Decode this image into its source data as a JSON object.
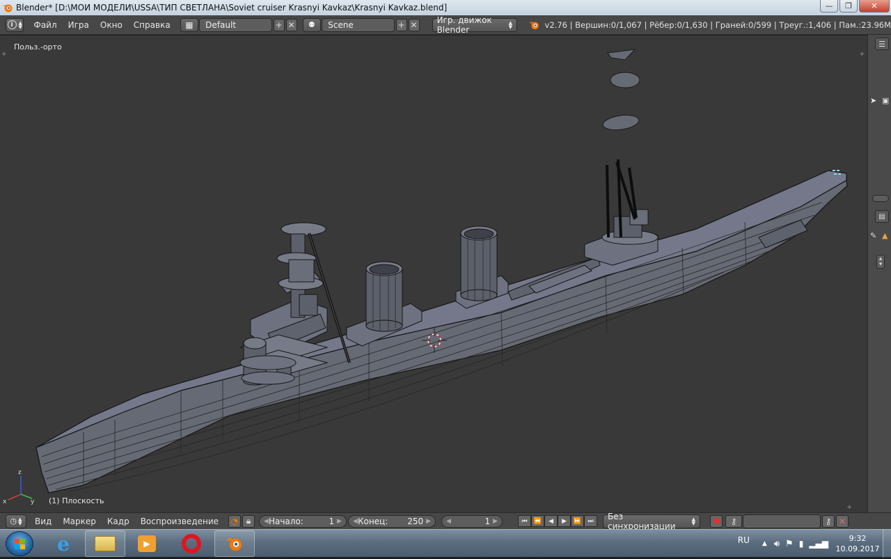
{
  "window": {
    "title": "Blender* [D:\\МОИ МОДЕЛИ\\USSA\\ТИП СВЕТЛАНА\\Soviet cruiser Krasnyi Kavkaz\\Krasnyi Kavkaz.blend]",
    "minimize": "—",
    "maximize": "❐",
    "close": "✕"
  },
  "info_header": {
    "menus": [
      "Файл",
      "Игра",
      "Окно",
      "Справка"
    ],
    "screen_layout": "Default",
    "scene": "Scene",
    "engine": "Игр. движок Blender",
    "stats": "v2.76 | Вершин:0/1,067 | Рёбер:0/1,630 | Граней:0/599 | Треуг.:1,406 | Пам.:23.96M"
  },
  "viewport": {
    "view_label": "Польз.-орто",
    "active_object": "(1) Плоскость",
    "axes": {
      "x": "x",
      "y": "y",
      "z": "z"
    }
  },
  "timeline": {
    "menus": [
      "Вид",
      "Маркер",
      "Кадр",
      "Воспроизведение"
    ],
    "start_label": "Начало:",
    "start_value": "1",
    "end_label": "Конец:",
    "end_value": "250",
    "current_frame": "1",
    "sync": "Без синхронизации"
  },
  "taskbar": {
    "apps": [
      "internet-explorer",
      "file-explorer",
      "media-player",
      "opera",
      "blender"
    ],
    "language": "RU",
    "time": "9:32",
    "date": "10.09.2017"
  },
  "colors": {
    "ship_fill": "#666a74",
    "viewport_bg": "#393939",
    "header_bg": "#474747"
  }
}
